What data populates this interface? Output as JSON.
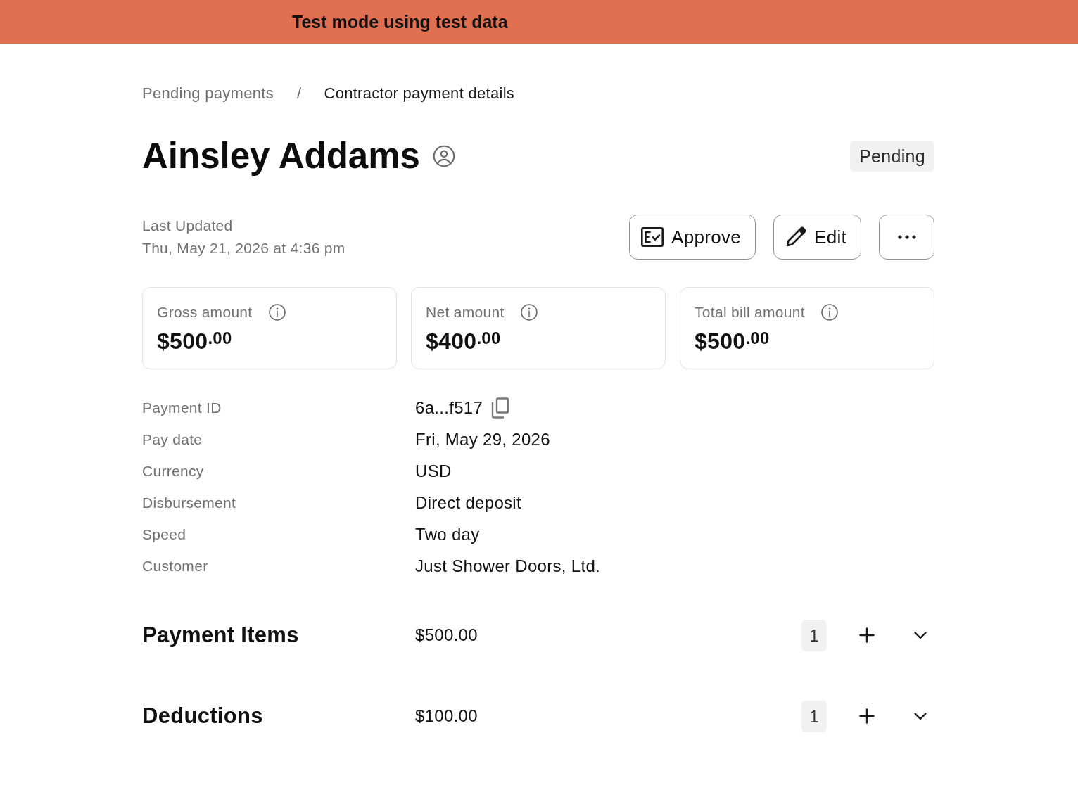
{
  "banner": {
    "text": "Test mode using test data"
  },
  "breadcrumb": {
    "items": [
      {
        "label": "Pending payments",
        "current": false
      },
      {
        "label": "Contractor payment details",
        "current": true
      }
    ],
    "separator": "/"
  },
  "header": {
    "title": "Ainsley Addams",
    "status": "Pending"
  },
  "last_updated": {
    "label": "Last Updated",
    "value": "Thu, May 21, 2026 at 4:36 pm"
  },
  "actions": [
    {
      "kind": "approve",
      "label": "Approve"
    },
    {
      "kind": "edit",
      "label": "Edit"
    },
    {
      "kind": "more"
    }
  ],
  "summary_cards": [
    {
      "label": "Gross amount",
      "amount": "$500$^{.00}$"
    },
    {
      "label": "Net amount",
      "amount": "$400$^{.00}$"
    },
    {
      "label": "Total bill amount",
      "amount": "$500$^{.00}$"
    }
  ],
  "details": [
    {
      "label": "Payment ID",
      "value": "6a...f517",
      "copyable": true
    },
    {
      "label": "Pay date",
      "value": "Fri, May 29, 2026",
      "copyable": false
    },
    {
      "label": "Currency",
      "value": "USD",
      "copyable": false
    },
    {
      "label": "Disbursement",
      "value": "Direct deposit",
      "copyable": false
    },
    {
      "label": "Speed",
      "value": "Two day",
      "copyable": false
    },
    {
      "label": "Customer",
      "value": "Just Shower Doors, Ltd.",
      "copyable": false
    }
  ],
  "sections": [
    {
      "title": "Payment Items",
      "amount": "$500.00",
      "count": "1",
      "expanded": false
    },
    {
      "title": "Deductions",
      "amount": "$100.00",
      "count": "1",
      "expanded": false
    }
  ]
}
